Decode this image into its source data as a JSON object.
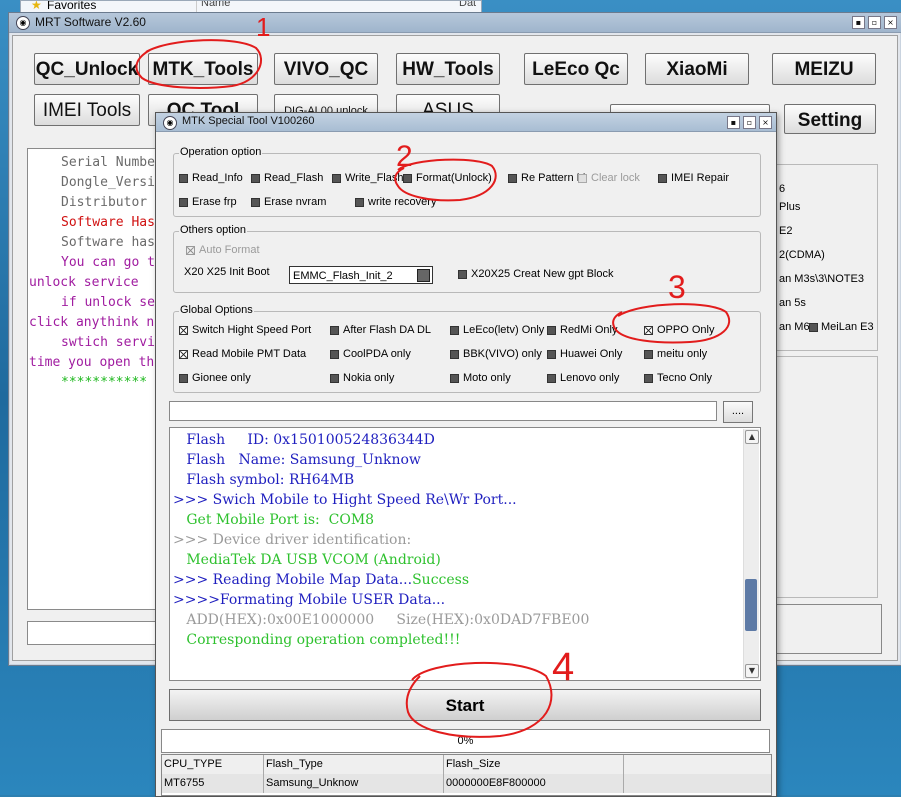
{
  "explorer": {
    "favorites": "Favorites",
    "col_name": "Name",
    "col_date": "Dat"
  },
  "main_window": {
    "title": "MRT Software V2.60",
    "buttons": {
      "qc_unlock": "QC_Unlock",
      "mtk_tools": "MTK_Tools",
      "vivo_qc": "VIVO_QC",
      "hw_tools": "HW_Tools",
      "leeco_qc": "LeEco Qc",
      "xiaomi": "XiaoMi",
      "meizu": "MEIZU",
      "imei_tools": "IMEI Tools",
      "qc_tool": "QC Tool",
      "dig_al00": "DIG-AL00 unlock",
      "asus": "ASUS",
      "setting": "Setting"
    },
    "info_lines": [
      "Serial Numbe",
      "Dongle_Versi",
      "Distributor",
      "Software Has",
      "Software has",
      "You can go t",
      "unlock service",
      "if unlock se",
      "click anythink n",
      "swtich servi",
      "time you open th",
      "***********"
    ],
    "right_panel": [
      "6",
      "Plus",
      "E2",
      "2(CDMA)",
      "an M3s\\3\\NOTE3",
      "an 5s",
      "an M6",
      "MeiLan E3"
    ]
  },
  "dialog": {
    "title": "MTK Special Tool V100260",
    "operation_option": {
      "label": "Operation option",
      "items": {
        "read_info": "Read_Info",
        "read_flash": "Read_Flash",
        "write_flash": "Write_Flash",
        "format_unlock": "Format(Unlock)",
        "re_pattern": "Re Pattern M",
        "clear_lock": "Clear lock",
        "imei_repair": "IMEI Repair",
        "erase_frp": "Erase frp",
        "erase_nvram": "Erase nvram",
        "write_recovery": "write recovery"
      }
    },
    "others_option": {
      "label": "Others option",
      "auto_format": "Auto Format",
      "init_boot_label": "X20 X25 Init Boot",
      "init_boot_value": "EMMC_Flash_Init_2",
      "creat_gpt": "X20X25 Creat New gpt Block"
    },
    "global_options": {
      "label": "Global Options",
      "items": {
        "switch_high_speed": "Switch Hight Speed Port",
        "after_flash_da_dl": "After Flash DA DL",
        "leeco_only": "LeEco(letv) Only",
        "redmi_only": "RedMi Only",
        "oppo_only": "OPPO Only",
        "read_mobile_pmt": "Read Mobile PMT Data",
        "coolpda_only": "CoolPDA only",
        "bbk_only": "BBK(VIVO) only",
        "huawei_only": "Huawei Only",
        "meitu_only": "meitu only",
        "gionee_only": "Gionee only",
        "nokia_only": "Nokia only",
        "moto_only": "Moto only",
        "lenovo_only": "Lenovo only",
        "tecno_only": "Tecno Only"
      }
    },
    "browse_label": "....",
    "log": [
      {
        "text": "   Flash     ID: 0x150100524836344D",
        "color": "#1f1fbf"
      },
      {
        "text": "   Flash   Name: Samsung_Unknow",
        "color": "#1f1fbf"
      },
      {
        "text": "   Flash symbol: RH64MB",
        "color": "#1f1fbf"
      },
      {
        "text": ">>> Swich Mobile to Hight Speed Re\\Wr Port...",
        "color": "#1f1fbf"
      },
      {
        "text": "   Get Mobile Port is:  COM8",
        "color": "#2ec12e"
      },
      {
        "text": ">>> Device driver identification:",
        "color": "#9a9a9a"
      },
      {
        "text": "   MediaTek DA USB VCOM (Android)",
        "color": "#2ec12e"
      },
      {
        "text": ">>> Reading Mobile Map Data...",
        "color": "#1f1fbf",
        "suffix": "Success",
        "suffix_color": "#2ec12e"
      },
      {
        "text": ">>>>Formating Mobile USER Data...",
        "color": "#1f1fbf"
      },
      {
        "text": "   ADD(HEX):0x00E1000000     Size(HEX):0x0DAD7FBE00",
        "color": "#9a9a9a"
      },
      {
        "text": "   Corresponding operation completed!!!",
        "color": "#2ec12e"
      }
    ],
    "start_label": "Start",
    "progress_text": "0%",
    "progress": 0,
    "table": {
      "headers": [
        "CPU_TYPE",
        "Flash_Type",
        "Flash_Size",
        ""
      ],
      "row": [
        "MT6755",
        "Samsung_Unknow",
        "0000000E8F800000",
        ""
      ]
    }
  },
  "annotations": {
    "n1": "1",
    "n2": "2",
    "n3": "3",
    "n4": "4",
    "color": "#e21c1c"
  }
}
